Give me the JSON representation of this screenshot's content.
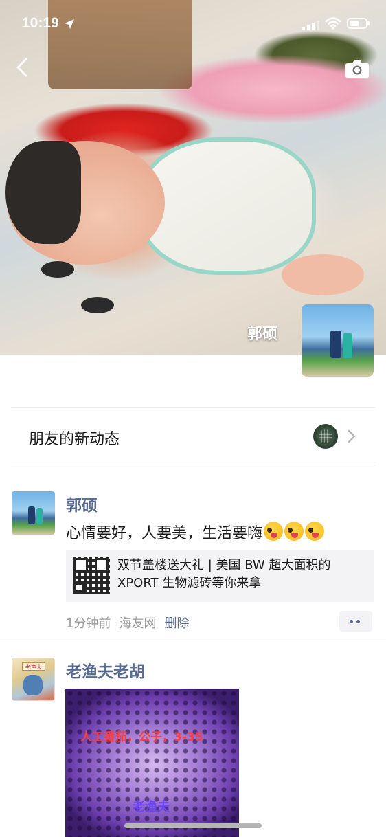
{
  "status_bar": {
    "time": "10:19",
    "battery_level": 0.6
  },
  "header": {
    "back_icon": "chevron-left-icon",
    "camera_icon": "camera-icon"
  },
  "cover": {
    "name": "郭硕"
  },
  "friend_updates": {
    "label": "朋友的新动态",
    "chevron_icon": "chevron-right-icon"
  },
  "posts": [
    {
      "name": "郭硕",
      "text": "心情要好，人要美，生活要嗨",
      "emoji_count": 3,
      "link_card": {
        "title": "双节盖楼送大礼 | 美国 BW 超大面积的 XPORT 生物滤砖等你来拿"
      },
      "time": "1分钟前",
      "source": "海友网",
      "delete_label": "删除"
    },
    {
      "name": "老渔夫老胡",
      "avatar_sign": "老渔夫",
      "image_text": "人工番茄，公子，3-35",
      "image_watermark": "老渔夫"
    }
  ]
}
